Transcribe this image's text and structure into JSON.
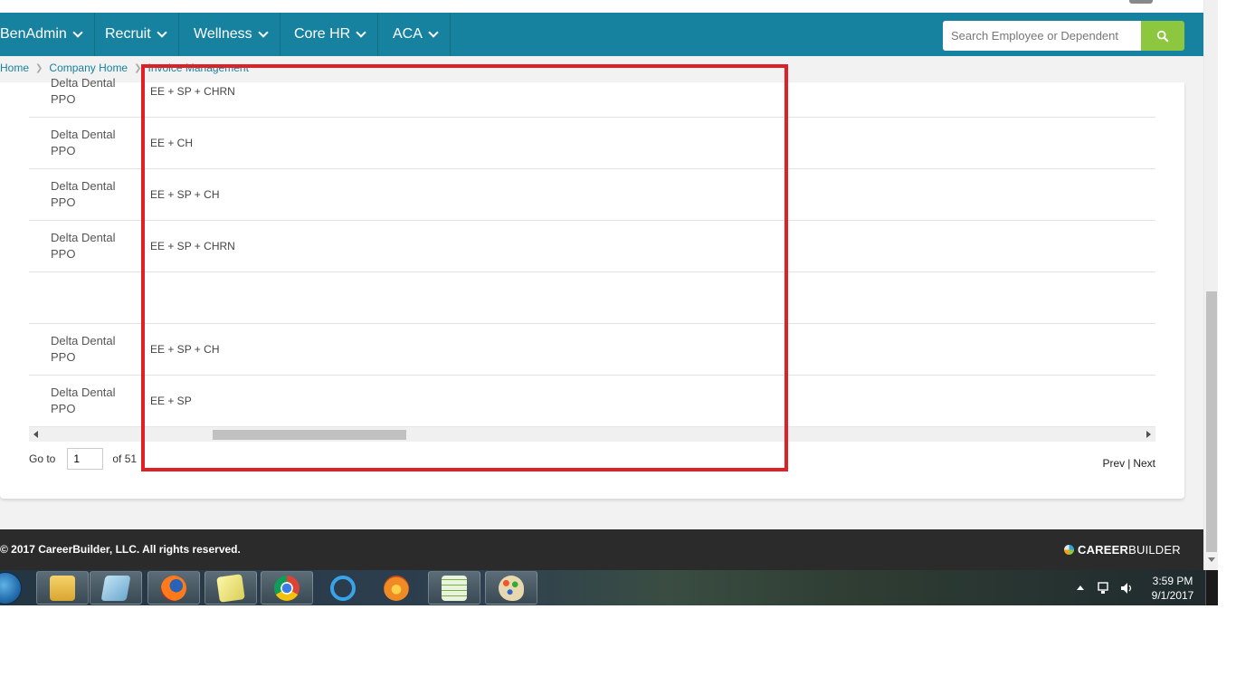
{
  "nav": {
    "items": [
      {
        "label": "BenAdmin"
      },
      {
        "label": "Recruit"
      },
      {
        "label": "Wellness"
      },
      {
        "label": "Core HR"
      },
      {
        "label": "ACA"
      }
    ],
    "search_placeholder": "Search Employee or Dependent"
  },
  "breadcrumb": {
    "items": [
      "Home",
      "Company Home",
      "Invoice Management"
    ]
  },
  "table": {
    "rows": [
      {
        "plan": "Delta Dental PPO",
        "tier": "EE + SP + CHRN"
      },
      {
        "plan": "Delta Dental PPO",
        "tier": "EE + CH"
      },
      {
        "plan": "Delta Dental PPO",
        "tier": "EE + SP + CH"
      },
      {
        "plan": "Delta Dental PPO",
        "tier": "EE + SP + CHRN"
      },
      {
        "plan": "",
        "tier": ""
      },
      {
        "plan": "Delta Dental PPO",
        "tier": "EE + SP + CH"
      },
      {
        "plan": "Delta Dental PPO",
        "tier": "EE + SP"
      }
    ]
  },
  "pager": {
    "goto_label": "Go to",
    "page_value": "1",
    "of_label": "of 51",
    "prev_label": "Prev",
    "separator": "|",
    "next_label": "Next"
  },
  "footer": {
    "copyright": "© 2017 CareerBuilder, LLC. All rights reserved.",
    "logo_bold": "CAREER",
    "logo_light": "BUILDER"
  },
  "taskbar": {
    "apps": [
      "file-explorer",
      "notepad",
      "firefox",
      "sticky-notes",
      "chrome",
      "internet-explorer",
      "firefox-alt",
      "spreadsheet",
      "paint"
    ],
    "time": "3:59 PM",
    "date": "9/1/2017"
  },
  "colors": {
    "nav_bg": "#17829f",
    "search_button": "#8dc63f",
    "highlight_border": "#e02027",
    "footer_bg": "#2b2b2b"
  }
}
